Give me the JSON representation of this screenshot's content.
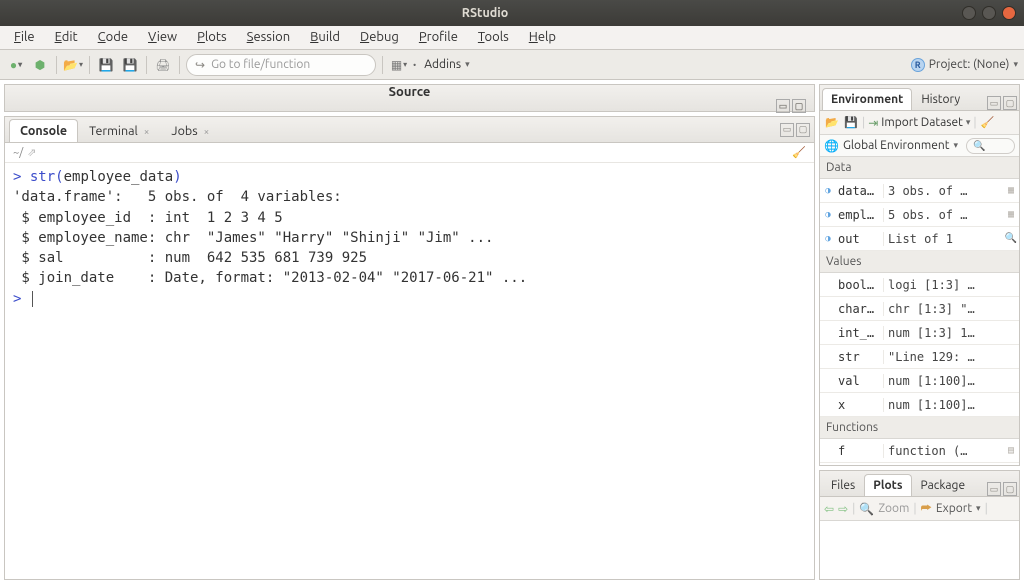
{
  "window": {
    "title": "RStudio"
  },
  "menu": {
    "items": [
      "File",
      "Edit",
      "Code",
      "View",
      "Plots",
      "Session",
      "Build",
      "Debug",
      "Profile",
      "Tools",
      "Help"
    ]
  },
  "toolbar": {
    "gotofile_placeholder": "Go to file/function",
    "addins_label": "Addins",
    "project_label": "Project: (None)"
  },
  "source": {
    "title": "Source"
  },
  "console": {
    "tabs": {
      "console": "Console",
      "terminal": "Terminal",
      "jobs": "Jobs"
    },
    "cwd": "~/",
    "prompt": ">",
    "input": {
      "fn": "str",
      "arg": "employee_data"
    },
    "output_lines": [
      "'data.frame':   5 obs. of  4 variables:",
      " $ employee_id  : int  1 2 3 4 5",
      " $ employee_name: chr  \"James\" \"Harry\" \"Shinji\" \"Jim\" ...",
      " $ sal          : num  642 535 681 739 925",
      " $ join_date    : Date, format: \"2013-02-04\" \"2017-06-21\" ..."
    ]
  },
  "environment": {
    "tabs": {
      "env": "Environment",
      "hist": "History"
    },
    "import_label": "Import Dataset",
    "scope_label": "Global Environment",
    "sections": {
      "data": "Data",
      "values": "Values",
      "functions": "Functions"
    },
    "data_rows": [
      {
        "name": "data…",
        "value": "3 obs. of …"
      },
      {
        "name": "empl…",
        "value": "5 obs. of …"
      },
      {
        "name": "out",
        "value": "List of 1"
      }
    ],
    "value_rows": [
      {
        "name": "bool…",
        "value": "logi [1:3] …"
      },
      {
        "name": "char…",
        "value": "chr [1:3] \"…"
      },
      {
        "name": "int_…",
        "value": "num [1:3] 1…"
      },
      {
        "name": "str",
        "value": "\"Line 129: …"
      },
      {
        "name": "val",
        "value": "num [1:100]…"
      },
      {
        "name": "x",
        "value": "num [1:100]…"
      }
    ],
    "function_rows": [
      {
        "name": "f",
        "value": "function (…"
      }
    ]
  },
  "files": {
    "tabs": {
      "files": "Files",
      "plots": "Plots",
      "packages": "Package"
    },
    "zoom_label": "Zoom",
    "export_label": "Export"
  }
}
